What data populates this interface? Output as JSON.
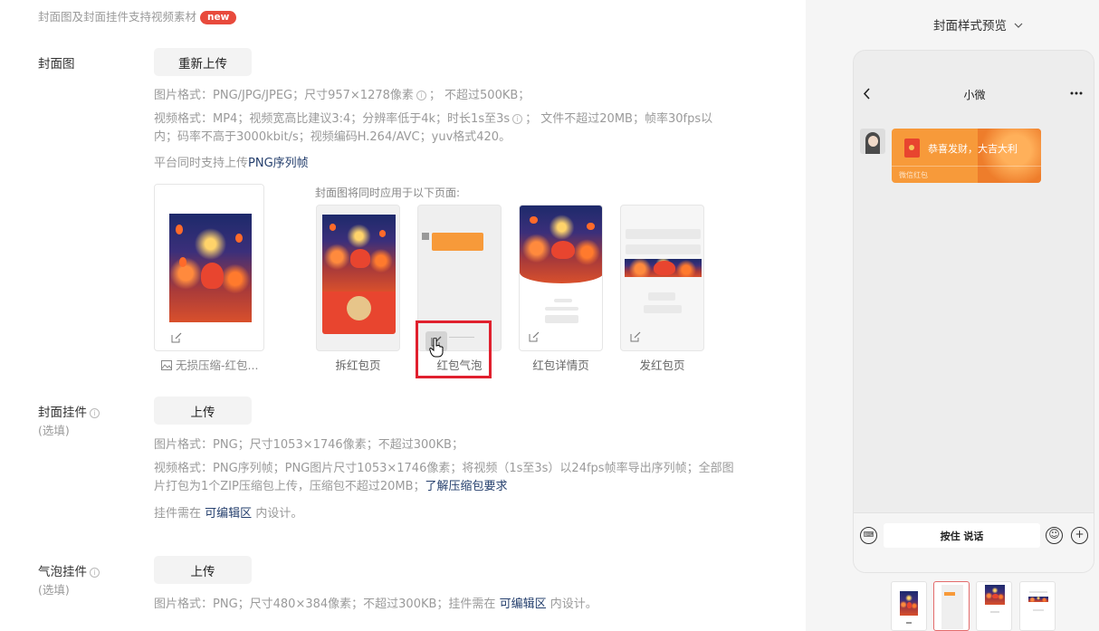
{
  "top_note": {
    "text": "封面图及封面挂件支持视频素材",
    "badge": "new"
  },
  "cover": {
    "label": "封面图",
    "button": "重新上传",
    "spec_image": "图片格式：PNG/JPG/JPEG；尺寸957×1278像素",
    "spec_image_tail": "；  不超过500KB；",
    "spec_video_line1a": "视频格式：MP4；视频宽高比建议3:4；分辨率低于4k；时长1s至3s",
    "spec_video_line1b": "；  文件不超过20MB；帧率30fps以",
    "spec_video_line2": "内；码率不高于3000kbit/s；视频编码H.264/AVC；yuv格式420。",
    "png_seq_prefix": "平台同时支持上传",
    "png_seq_link": "PNG序列帧",
    "file_name": "无损压缩-红包...",
    "apply_note": "封面图将同时应用于以下页面:",
    "pages": [
      "拆红包页",
      "红包气泡",
      "红包详情页",
      "发红包页"
    ],
    "poster_text": "恭喜发财，大吉大利"
  },
  "pendant": {
    "label": "封面挂件",
    "optional": "(选填)",
    "button": "上传",
    "spec_image": "图片格式：PNG；尺寸1053×1746像素；不超过300KB；",
    "spec_video_line1": "视频格式：PNG序列帧；PNG图片尺寸1053×1746像素；将视频（1s至3s）以24fps帧率导出序列帧；全部图",
    "spec_video_line2": "片打包为1个ZIP压缩包上传，压缩包不超过20MB；",
    "zip_link": "了解压缩包要求",
    "design_prefix": "挂件需在",
    "design_link": "可编辑区",
    "design_suffix": "内设计。"
  },
  "bubble": {
    "label": "气泡挂件",
    "optional": "(选填)",
    "button": "上传",
    "spec_prefix": "图片格式：PNG；尺寸480×384像素；不超过300KB；挂件需在",
    "design_link": "可编辑区",
    "spec_suffix": "内设计。"
  },
  "preview": {
    "title": "封面样式预览",
    "chat_name": "小微",
    "bubble_text": "恭喜发财，大吉大利",
    "bubble_footer": "微信红包",
    "input_label": "按住 说话"
  },
  "icons": [
    "info-icon",
    "edit-icon",
    "image-icon",
    "chevron-down-icon",
    "back-icon",
    "more-icon",
    "voice-icon",
    "emoji-icon",
    "plus-icon",
    "hand-cursor-icon"
  ],
  "colors": {
    "accent_link": "#26406e",
    "badge": "#e84a3c",
    "highlight": "#e0202e",
    "redpacket_orange": "#f79a3a"
  }
}
